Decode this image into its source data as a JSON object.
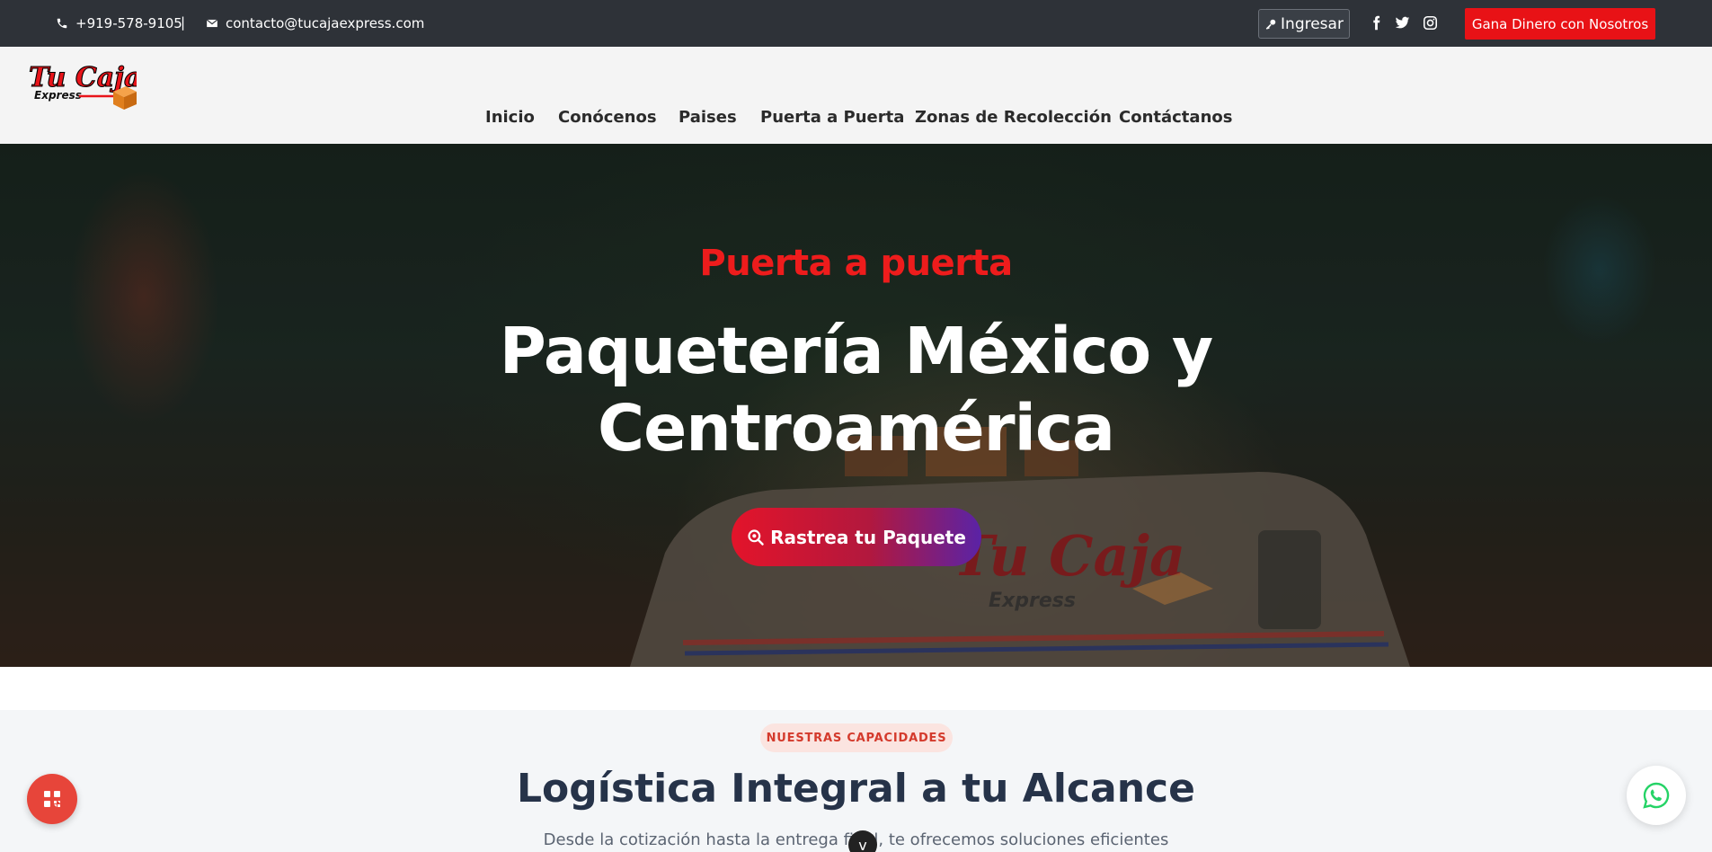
{
  "topbar": {
    "phone": "+919-578-9105",
    "separator": "|",
    "email": "contacto@tucajaexpress.com",
    "login_label": "Ingresar",
    "social_icons": [
      "facebook-icon",
      "twitter-icon",
      "instagram-icon"
    ],
    "cta_label": "Gana Dinero con Nosotros"
  },
  "logo": {
    "line1": "Tu Caja",
    "line2": "Express"
  },
  "nav": {
    "items": [
      "Inicio",
      "Conócenos",
      "Paises",
      "Puerta a Puerta",
      "Zonas de Recolección",
      "Contáctanos"
    ]
  },
  "hero": {
    "subtitle": "Puerta a puerta",
    "title_line1": "Paquetería México y",
    "title_line2": "Centroamérica",
    "button_label": "Rastrea tu Paquete",
    "van_logo": "Tu Caja",
    "van_logo_sub": "Express"
  },
  "capabilities": {
    "badge": "NUESTRAS CAPACIDADES",
    "title": "Logística Integral a tu Alcance",
    "description": "Desde la cotización hasta la entrega final, te ofrecemos soluciones eficientes"
  },
  "colors": {
    "topbar_bg": "#2e3238",
    "accent_red": "#e81216",
    "button_gradient_start": "#e3142a",
    "button_gradient_end": "#5a23a6",
    "heading_dark": "#263349",
    "whatsapp_green": "#25d366"
  },
  "floating": {
    "left_icon": "menu-grid-icon",
    "right_icon": "whatsapp-icon",
    "scroll_icon": "chevron-down-icon",
    "scroll_glyph": "v"
  }
}
